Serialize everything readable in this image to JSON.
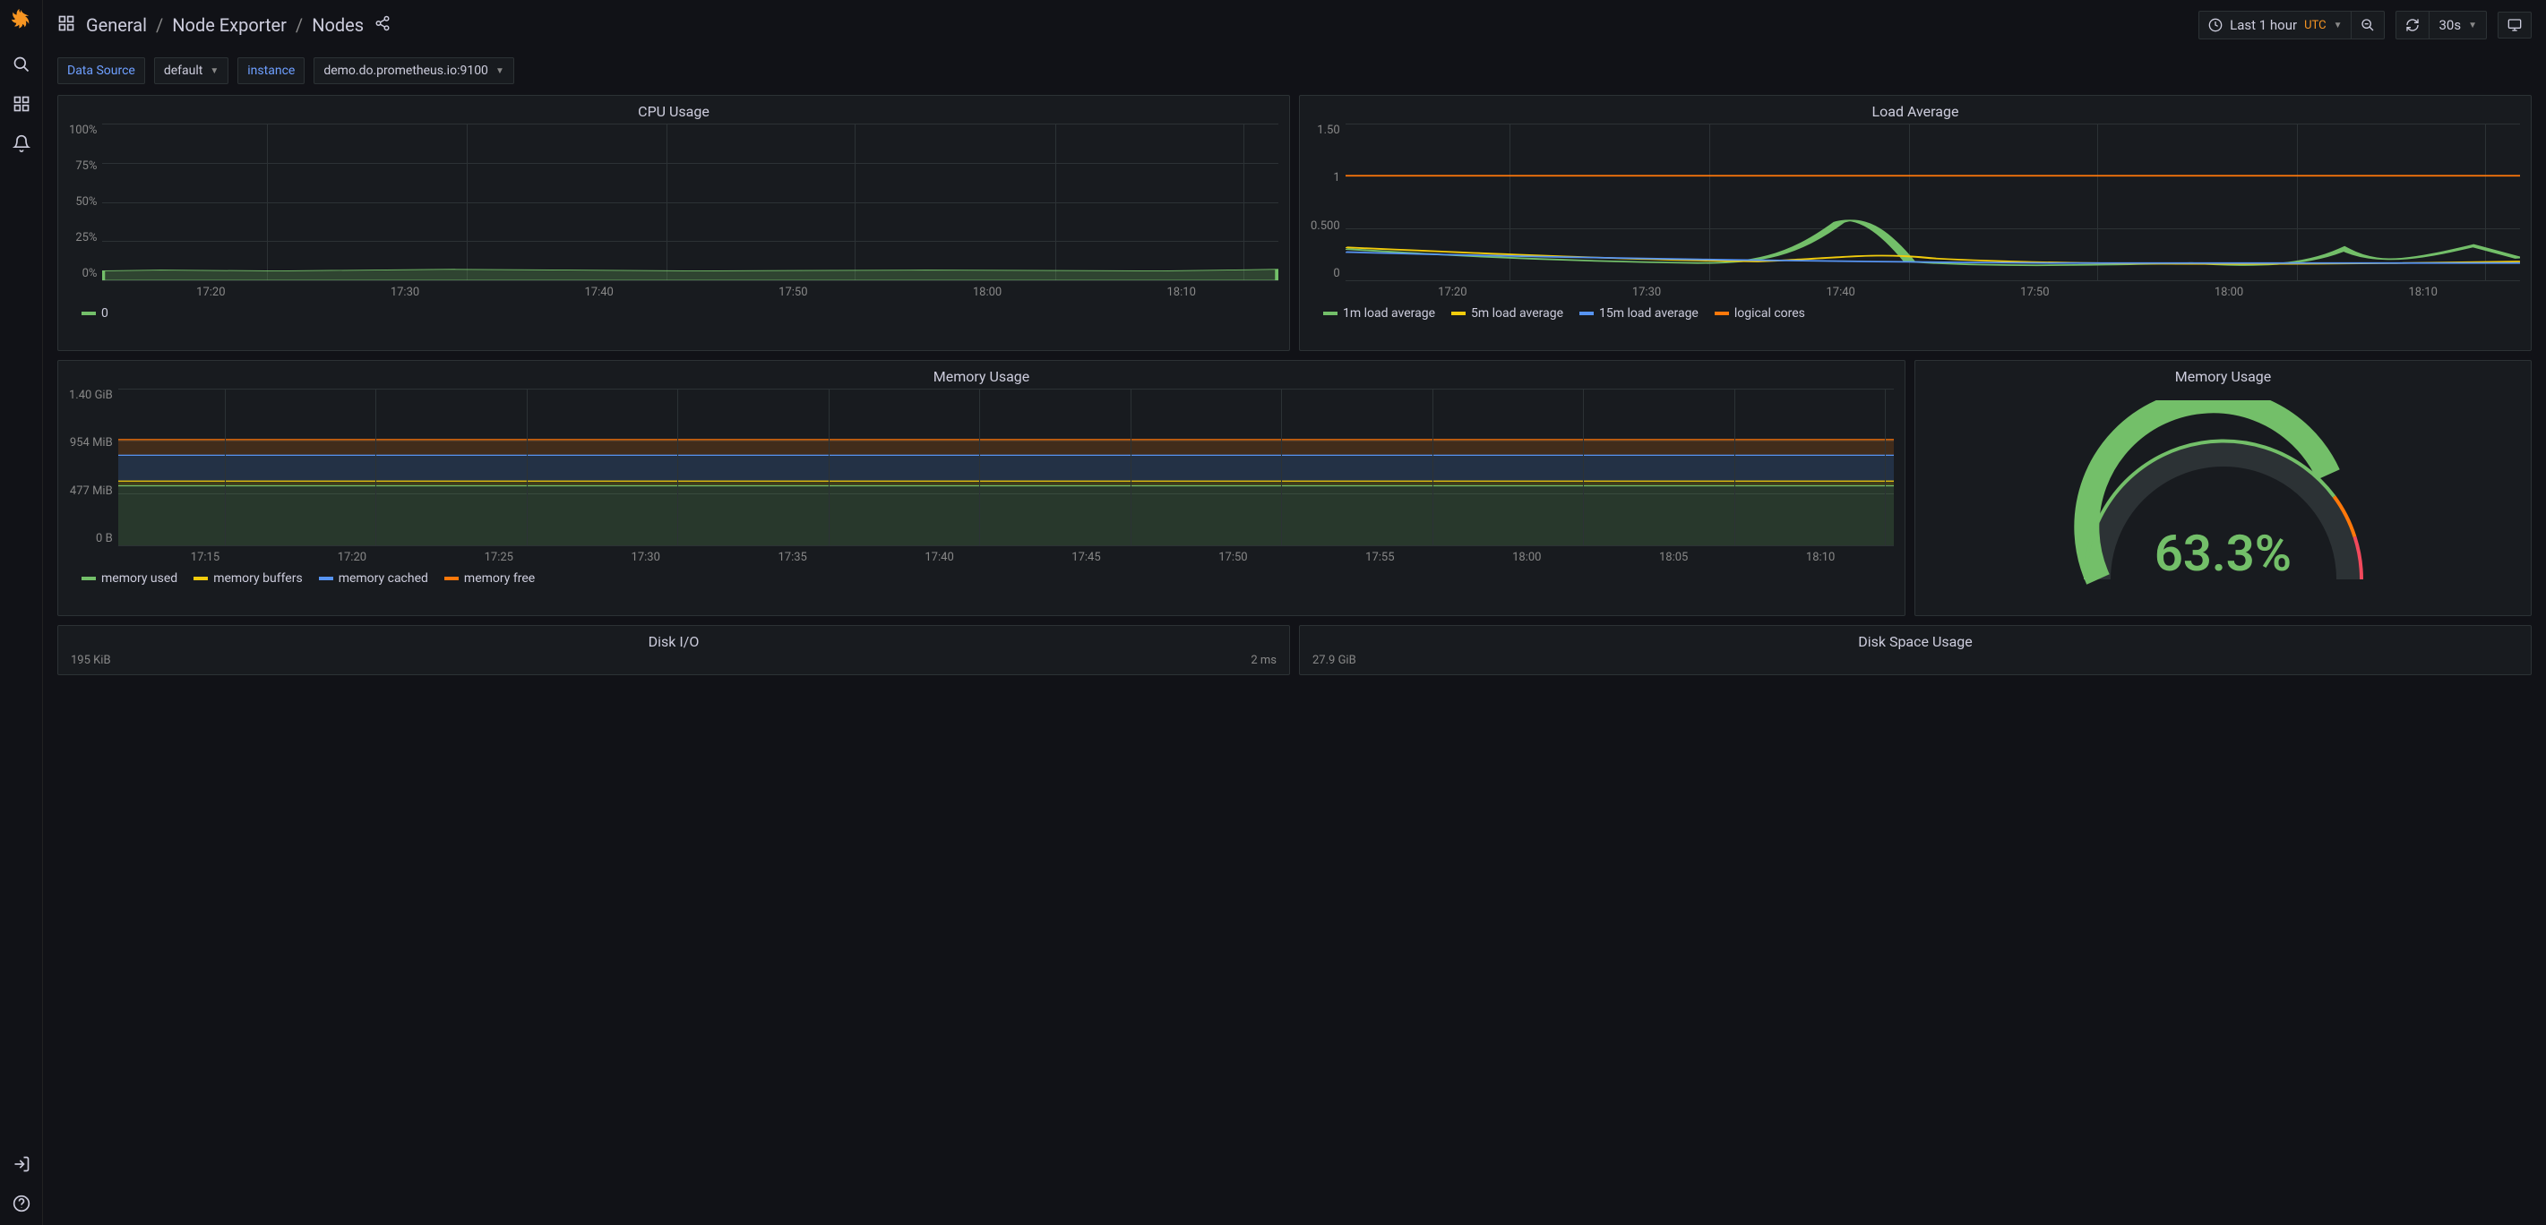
{
  "breadcrumb": {
    "root": "General",
    "sep": "/",
    "mid": "Node Exporter",
    "leaf": "Nodes"
  },
  "toolbar": {
    "time_label": "Last 1 hour",
    "tz": "UTC",
    "refresh_interval": "30s"
  },
  "vars": {
    "datasource_label": "Data Source",
    "datasource_value": "default",
    "instance_label": "instance",
    "instance_value": "demo.do.prometheus.io:9100"
  },
  "panels": {
    "cpu": {
      "title": "CPU Usage",
      "yticks": [
        "100%",
        "75%",
        "50%",
        "25%",
        "0%"
      ],
      "xticks": [
        "17:20",
        "17:30",
        "17:40",
        "17:50",
        "18:00",
        "18:10"
      ],
      "legend": [
        {
          "label": "0",
          "color": "#73bf69"
        }
      ]
    },
    "load": {
      "title": "Load Average",
      "yticks": [
        "1.50",
        "1",
        "0.500",
        "0"
      ],
      "xticks": [
        "17:20",
        "17:30",
        "17:40",
        "17:50",
        "18:00",
        "18:10"
      ],
      "legend": [
        {
          "label": "1m load average",
          "color": "#73bf69"
        },
        {
          "label": "5m load average",
          "color": "#f2cc0c"
        },
        {
          "label": "15m load average",
          "color": "#5794f2"
        },
        {
          "label": "logical cores",
          "color": "#ff780a"
        }
      ]
    },
    "mem": {
      "title": "Memory Usage",
      "yticks": [
        "1.40 GiB",
        "954 MiB",
        "477 MiB",
        "0 B"
      ],
      "xticks": [
        "17:15",
        "17:20",
        "17:25",
        "17:30",
        "17:35",
        "17:40",
        "17:45",
        "17:50",
        "17:55",
        "18:00",
        "18:05",
        "18:10"
      ],
      "legend": [
        {
          "label": "memory used",
          "color": "#73bf69"
        },
        {
          "label": "memory buffers",
          "color": "#f2cc0c"
        },
        {
          "label": "memory cached",
          "color": "#5794f2"
        },
        {
          "label": "memory free",
          "color": "#ff780a"
        }
      ]
    },
    "mem_gauge": {
      "title": "Memory Usage",
      "value": "63.3%"
    },
    "diskio": {
      "title": "Disk I/O",
      "yleft": "195 KiB",
      "yright": "2 ms"
    },
    "diskspace": {
      "title": "Disk Space Usage",
      "yleft": "27.9 GiB"
    }
  },
  "chart_data": [
    {
      "type": "area",
      "title": "CPU Usage",
      "ylabel": "%",
      "ylim": [
        0,
        100
      ],
      "x_range": [
        "17:12",
        "18:12"
      ],
      "series": [
        {
          "name": "0",
          "color": "#73bf69",
          "approx_constant_value": 6
        }
      ],
      "xticks": [
        "17:20",
        "17:30",
        "17:40",
        "17:50",
        "18:00",
        "18:10"
      ]
    },
    {
      "type": "line",
      "title": "Load Average",
      "ylim": [
        0,
        1.5
      ],
      "x_range": [
        "17:12",
        "18:12"
      ],
      "xticks": [
        "17:20",
        "17:30",
        "17:40",
        "17:50",
        "18:00",
        "18:10"
      ],
      "series": [
        {
          "name": "logical cores",
          "color": "#ff780a",
          "approx_constant_value": 1.0
        },
        {
          "name": "15m load average",
          "color": "#5794f2",
          "approx_range": [
            0.12,
            0.2
          ],
          "approx_mean": 0.16
        },
        {
          "name": "5m load average",
          "color": "#f2cc0c",
          "approx_range": [
            0.08,
            0.28
          ],
          "approx_mean": 0.16
        },
        {
          "name": "1m load average",
          "color": "#73bf69",
          "approx_range": [
            0.03,
            0.55
          ],
          "approx_mean": 0.15,
          "peak_at": "17:37",
          "peak_value": 0.55
        }
      ]
    },
    {
      "type": "area",
      "title": "Memory Usage",
      "ylim_bytes": [
        0,
        1503238553
      ],
      "yticks": [
        "0 B",
        "477 MiB",
        "954 MiB",
        "1.40 GiB"
      ],
      "x_range": [
        "17:12",
        "18:12"
      ],
      "xticks": [
        "17:15",
        "17:20",
        "17:25",
        "17:30",
        "17:35",
        "17:40",
        "17:45",
        "17:50",
        "17:55",
        "18:00",
        "18:05",
        "18:10"
      ],
      "stacked": true,
      "series": [
        {
          "name": "memory used",
          "color": "#73bf69",
          "approx_constant_mib": 540
        },
        {
          "name": "memory buffers",
          "color": "#f2cc0c",
          "approx_constant_mib": 40
        },
        {
          "name": "memory cached",
          "color": "#5794f2",
          "approx_constant_mib": 235
        },
        {
          "name": "memory free",
          "color": "#ff780a",
          "approx_constant_mib": 145
        }
      ],
      "stack_top_mib": 960
    },
    {
      "type": "gauge",
      "title": "Memory Usage",
      "value_percent": 63.3,
      "min": 0,
      "max": 100,
      "thresholds": [
        {
          "from": 0,
          "to": 80,
          "color": "#73bf69"
        },
        {
          "from": 80,
          "to": 90,
          "color": "#ff780a"
        },
        {
          "from": 90,
          "to": 100,
          "color": "#f2495c"
        }
      ]
    }
  ]
}
